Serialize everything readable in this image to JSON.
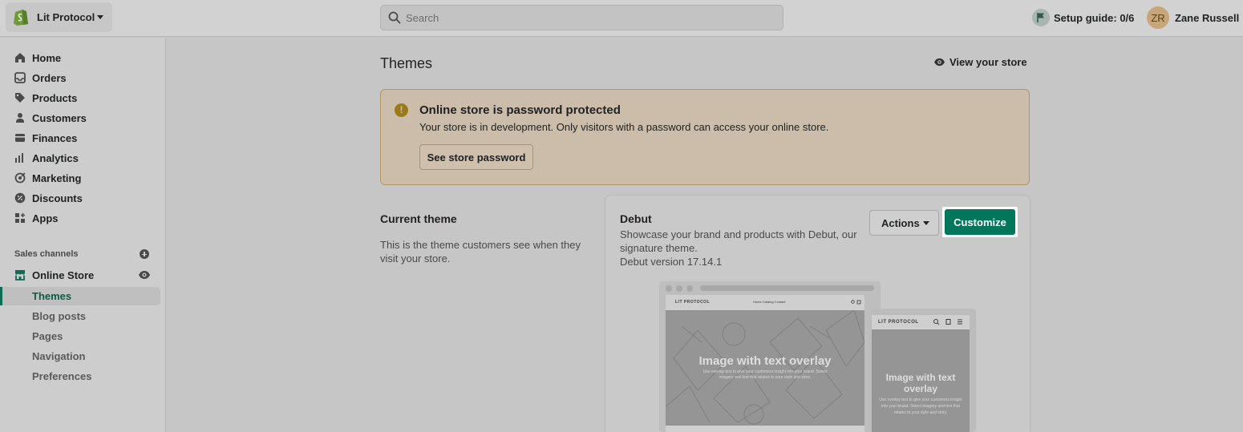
{
  "topbar": {
    "store_name": "Lit Protocol",
    "search_placeholder": "Search",
    "setup_guide": "Setup guide: 0/6",
    "user_initials": "ZR",
    "user_name": "Zane Russell"
  },
  "sidebar": {
    "items": [
      {
        "label": "Home",
        "icon": "home-icon"
      },
      {
        "label": "Orders",
        "icon": "orders-icon"
      },
      {
        "label": "Products",
        "icon": "tag-icon"
      },
      {
        "label": "Customers",
        "icon": "person-icon"
      },
      {
        "label": "Finances",
        "icon": "finances-icon"
      },
      {
        "label": "Analytics",
        "icon": "bar-chart-icon"
      },
      {
        "label": "Marketing",
        "icon": "target-icon"
      },
      {
        "label": "Discounts",
        "icon": "discount-icon"
      },
      {
        "label": "Apps",
        "icon": "apps-icon"
      }
    ],
    "sales_channels_label": "Sales channels",
    "online_store_label": "Online Store",
    "sub_items": [
      {
        "label": "Themes",
        "active": true
      },
      {
        "label": "Blog posts",
        "active": false
      },
      {
        "label": "Pages",
        "active": false
      },
      {
        "label": "Navigation",
        "active": false
      },
      {
        "label": "Preferences",
        "active": false
      }
    ]
  },
  "main": {
    "title": "Themes",
    "view_store": "View your store",
    "banner": {
      "title": "Online store is password protected",
      "text": "Your store is in development. Only visitors with a password can access your online store.",
      "button": "See store password"
    },
    "current_theme": {
      "heading": "Current theme",
      "description": "This is the theme customers see when they visit your store."
    },
    "theme_card": {
      "name": "Debut",
      "description": "Showcase your brand and products with Debut, our signature theme.",
      "version": "Debut version 17.14.1",
      "actions_label": "Actions",
      "customize_label": "Customize"
    },
    "preview": {
      "desktop_logo": "LIT PROTOCOL",
      "desktop_links": "Home   Catalog   Contact",
      "desktop_hero_title": "Image with text overlay",
      "desktop_hero_sub": "Use overlay text to give your customers insight into your brand. Select imagery and text that relates to your style and story.",
      "mobile_logo": "LIT PROTOCOL",
      "mobile_hero_title": "Image with text overlay",
      "mobile_hero_sub": "Use overlay text to give your customers insight into your brand. Select imagery and text that relates to your style and story."
    }
  },
  "colors": {
    "accent": "#00765b",
    "banner_bg": "#ccbdab",
    "banner_icon": "#9a7a17"
  }
}
